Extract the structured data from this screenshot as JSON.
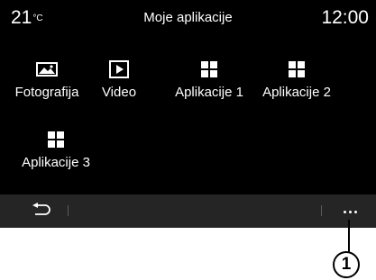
{
  "status": {
    "temperature": "21",
    "temperature_unit": "°C",
    "title": "Moje aplikacije",
    "time": "12:00"
  },
  "apps": [
    {
      "label": "Fotografija",
      "icon": "photo-icon"
    },
    {
      "label": "Video",
      "icon": "play-icon"
    },
    {
      "label": "Aplikacije 1",
      "icon": "grid-icon"
    },
    {
      "label": "Aplikacije 2",
      "icon": "grid-icon"
    },
    {
      "label": "Aplikacije 3",
      "icon": "grid-icon"
    }
  ],
  "bottom_bar": {
    "back_icon": "back-arrow-icon",
    "more_icon": "more-options-icon"
  },
  "callout": {
    "number": "1"
  },
  "colors": {
    "screen_background": "#000000",
    "bottom_bar": "#252525",
    "text": "#ffffff"
  }
}
